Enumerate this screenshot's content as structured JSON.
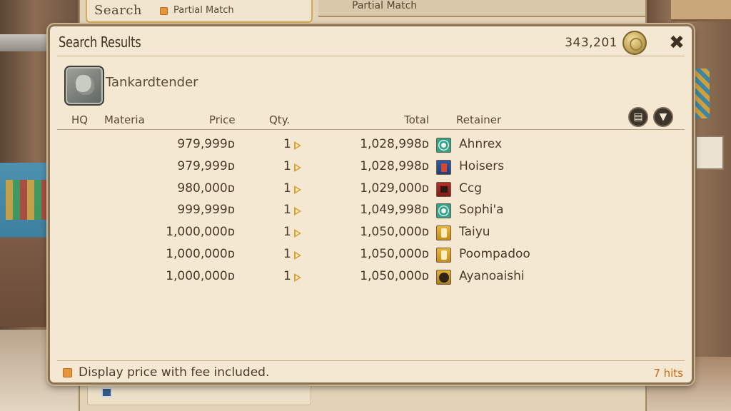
{
  "background": {
    "search_label": "Search",
    "partial_match_label": "Partial Match",
    "header_partial_match": "Partial Match"
  },
  "window": {
    "title": "Search Results",
    "gil": "343,201",
    "icons": [
      "gil-coin-icon",
      "close-icon"
    ]
  },
  "item": {
    "name": "Tankardtender",
    "icon": "item-icon"
  },
  "columns": {
    "hq": "HQ",
    "materia": "Materia",
    "price": "Price",
    "qty": "Qty.",
    "total": "Total",
    "retainer": "Retainer"
  },
  "header_buttons": {
    "list_icon": "▤",
    "filter_icon": "▼"
  },
  "listings": [
    {
      "price": "979,999ᴅ",
      "qty": "1",
      "total": "1,028,998ᴅ",
      "retainer": "Ahnrex",
      "icon_color": "teal"
    },
    {
      "price": "979,999ᴅ",
      "qty": "1",
      "total": "1,028,998ᴅ",
      "retainer": "Hoisers",
      "icon_color": "blue"
    },
    {
      "price": "980,000ᴅ",
      "qty": "1",
      "total": "1,029,000ᴅ",
      "retainer": "Ccg",
      "icon_color": "red"
    },
    {
      "price": "999,999ᴅ",
      "qty": "1",
      "total": "1,049,998ᴅ",
      "retainer": "Sophi'a",
      "icon_color": "teal"
    },
    {
      "price": "1,000,000ᴅ",
      "qty": "1",
      "total": "1,050,000ᴅ",
      "retainer": "Taiyu",
      "icon_color": "gold"
    },
    {
      "price": "1,000,000ᴅ",
      "qty": "1",
      "total": "1,050,000ᴅ",
      "retainer": "Poompadoo",
      "icon_color": "gold"
    },
    {
      "price": "1,000,000ᴅ",
      "qty": "1",
      "total": "1,050,000ᴅ",
      "retainer": "Ayanoaishi",
      "icon_color": "dark"
    }
  ],
  "footer": {
    "fee_label": "Display price with fee included.",
    "hits": "7 hits"
  },
  "colors": {
    "window_bg": "#f5e8d3",
    "checkbox": "#e8963c",
    "hits": "#c56a16"
  }
}
